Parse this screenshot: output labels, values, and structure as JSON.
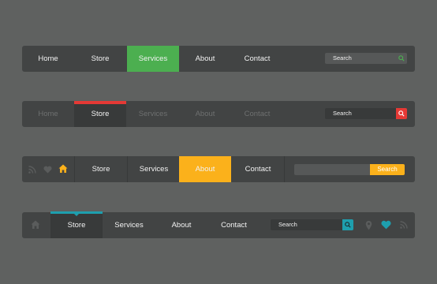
{
  "colors": {
    "background": "#5f6160",
    "bar": "#424444",
    "green": "#4caf50",
    "red": "#e53935",
    "yellow": "#fbb11b",
    "teal": "#1e9fae"
  },
  "nav1": {
    "items": [
      "Home",
      "Store",
      "Services",
      "About",
      "Contact"
    ],
    "active": "Services",
    "search_label": "Search",
    "search_icon": "search-icon"
  },
  "nav2": {
    "items": [
      "Home",
      "Store",
      "Services",
      "About",
      "Contact"
    ],
    "active": "Store",
    "search_label": "Search",
    "search_icon": "search-icon"
  },
  "nav3": {
    "icons": [
      "rss-icon",
      "heart-icon",
      "home-icon"
    ],
    "items": [
      "Store",
      "Services",
      "About",
      "Contact"
    ],
    "active": "About",
    "search_button": "Search"
  },
  "nav4": {
    "icons": [
      "home-icon",
      "location-pin-icon",
      "heart-icon",
      "rss-icon"
    ],
    "items": [
      "Store",
      "Services",
      "About",
      "Contact"
    ],
    "active": "Store",
    "search_label": "Search",
    "search_icon": "search-icon"
  }
}
